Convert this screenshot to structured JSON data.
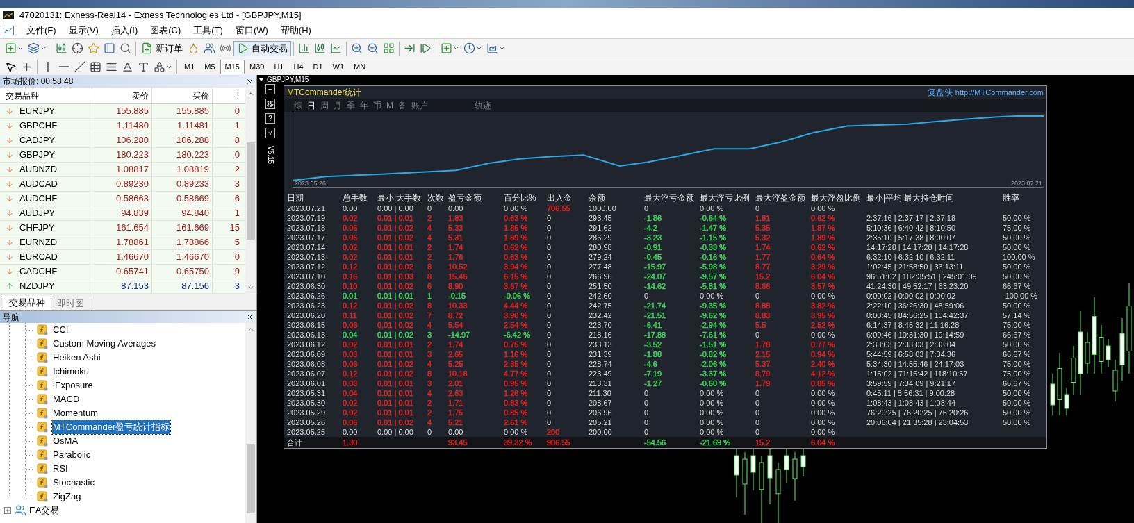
{
  "window": {
    "title": "47020131: Exness-Real14 - Exness Technologies Ltd - [GBPJPY,M15]"
  },
  "menu": [
    "文件(F)",
    "显示(V)",
    "插入(I)",
    "图表(C)",
    "工具(T)",
    "窗口(W)",
    "帮助(H)"
  ],
  "toolbar": {
    "new_order": "新订单",
    "auto_trading": "自动交易"
  },
  "timeframes": [
    {
      "label": "M1",
      "selected": false
    },
    {
      "label": "M5",
      "selected": false
    },
    {
      "label": "M15",
      "selected": true
    },
    {
      "label": "M30",
      "selected": false
    },
    {
      "label": "H1",
      "selected": false
    },
    {
      "label": "H4",
      "selected": false
    },
    {
      "label": "D1",
      "selected": false
    },
    {
      "label": "W1",
      "selected": false
    },
    {
      "label": "MN",
      "selected": false
    }
  ],
  "market_watch": {
    "title": "市场报价: 00:58:48",
    "columns": [
      "交易品种",
      "卖价",
      "买价",
      "!"
    ],
    "rows": [
      {
        "symbol": "EURJPY",
        "bid": "155.885",
        "ask": "155.885",
        "spread": "0",
        "kind": "down"
      },
      {
        "symbol": "GBPCHF",
        "bid": "1.11480",
        "ask": "1.11481",
        "spread": "1",
        "kind": "down"
      },
      {
        "symbol": "CADJPY",
        "bid": "106.280",
        "ask": "106.288",
        "spread": "8",
        "kind": "down"
      },
      {
        "symbol": "GBPJPY",
        "bid": "180.223",
        "ask": "180.223",
        "spread": "0",
        "kind": "down"
      },
      {
        "symbol": "AUDNZD",
        "bid": "1.08817",
        "ask": "1.08819",
        "spread": "2",
        "kind": "down"
      },
      {
        "symbol": "AUDCAD",
        "bid": "0.89230",
        "ask": "0.89233",
        "spread": "3",
        "kind": "down"
      },
      {
        "symbol": "AUDCHF",
        "bid": "0.58663",
        "ask": "0.58669",
        "spread": "6",
        "kind": "down"
      },
      {
        "symbol": "AUDJPY",
        "bid": "94.839",
        "ask": "94.840",
        "spread": "1",
        "kind": "down"
      },
      {
        "symbol": "CHFJPY",
        "bid": "161.654",
        "ask": "161.669",
        "spread": "15",
        "kind": "down"
      },
      {
        "symbol": "EURNZD",
        "bid": "1.78861",
        "ask": "1.78866",
        "spread": "5",
        "kind": "down"
      },
      {
        "symbol": "EURCAD",
        "bid": "1.46670",
        "ask": "1.46670",
        "spread": "0",
        "kind": "down"
      },
      {
        "symbol": "CADCHF",
        "bid": "0.65741",
        "ask": "0.65750",
        "spread": "9",
        "kind": "down"
      },
      {
        "symbol": "NZDJPY",
        "bid": "87.153",
        "ask": "87.156",
        "spread": "3",
        "kind": "up"
      }
    ]
  },
  "market_tabs": [
    {
      "label": "交易品种",
      "selected": true
    },
    {
      "label": "即时图",
      "selected": false
    }
  ],
  "navigator": {
    "title": "导航",
    "items": [
      {
        "label": "CCI",
        "selected": false
      },
      {
        "label": "Custom Moving Averages",
        "selected": false
      },
      {
        "label": "Heiken Ashi",
        "selected": false
      },
      {
        "label": "Ichimoku",
        "selected": false
      },
      {
        "label": "iExposure",
        "selected": false
      },
      {
        "label": "MACD",
        "selected": false
      },
      {
        "label": "Momentum",
        "selected": false
      },
      {
        "label": "MTCommander盈亏统计指标",
        "selected": true
      },
      {
        "label": "OsMA",
        "selected": false
      },
      {
        "label": "Parabolic",
        "selected": false
      },
      {
        "label": "RSI",
        "selected": false
      },
      {
        "label": "Stochastic",
        "selected": false
      },
      {
        "label": "ZigZag",
        "selected": false
      }
    ],
    "folder": {
      "label": "EA交易",
      "expanded": false
    }
  },
  "chart": {
    "title": "GBPJPY,M15",
    "side_buttons": [
      "−",
      "移",
      "?",
      "√"
    ],
    "version": "V5.15"
  },
  "stats_panel": {
    "title": "MTCommander统计",
    "brand": "复盘侠",
    "url": "http://MTCommander.com",
    "tabs": [
      {
        "label": "综",
        "selected": false
      },
      {
        "label": "日",
        "selected": true
      },
      {
        "label": "周",
        "selected": false
      },
      {
        "label": "月",
        "selected": false
      },
      {
        "label": "季",
        "selected": false
      },
      {
        "label": "年",
        "selected": false
      },
      {
        "label": "币",
        "selected": false
      },
      {
        "label": "M",
        "selected": false
      },
      {
        "label": "备",
        "selected": false
      },
      {
        "label": "账户",
        "selected": false
      },
      {
        "label": "轨迹",
        "selected": false
      }
    ],
    "start_label": "2023.05.26",
    "end_label": "2023.07.21",
    "columns": [
      "日期",
      "总手数",
      "最小|大手数",
      "次数",
      "盈亏金额",
      "百分比%",
      "出入金",
      "余额",
      "最大浮亏金额",
      "最大浮亏比例",
      "最大浮盈金额",
      "最大浮盈比例",
      "最小|平均|最大持仓时间",
      "胜率"
    ],
    "rows": [
      {
        "cells": [
          "2023.07.21",
          "0.00",
          "0.00 | 0.00",
          "0",
          "0.00",
          "0.00 %",
          {
            "text": "706.55",
            "color": "#e02424"
          },
          "1000.00",
          "0",
          "0.00 %",
          "0",
          "0.00 %",
          null,
          null
        ]
      },
      {
        "cells": [
          "2023.07.19",
          {
            "text": "0.02",
            "color": "#e02424"
          },
          {
            "text": "0.01 | 0.01",
            "color": "#e02424"
          },
          {
            "text": "2",
            "color": "#e02424"
          },
          {
            "text": "1.83",
            "color": "#e02424"
          },
          {
            "text": "0.63 %",
            "color": "#e02424"
          },
          "0",
          "293.45",
          {
            "text": "-1.86",
            "color": "#3fd35a"
          },
          {
            "text": "-0.64 %",
            "color": "#3fd35a"
          },
          {
            "text": "1.81",
            "color": "#e02424"
          },
          {
            "text": "0.62 %",
            "color": "#e02424"
          },
          "2:37:16 | 2:37:17 | 2:37:18",
          "50.00 %"
        ]
      },
      {
        "cells": [
          "2023.07.18",
          {
            "text": "0.06",
            "color": "#e02424"
          },
          {
            "text": "0.01 | 0.02",
            "color": "#e02424"
          },
          {
            "text": "4",
            "color": "#e02424"
          },
          {
            "text": "5.33",
            "color": "#e02424"
          },
          {
            "text": "1.86 %",
            "color": "#e02424"
          },
          "0",
          "291.62",
          {
            "text": "-4.2",
            "color": "#3fd35a"
          },
          {
            "text": "-1.47 %",
            "color": "#3fd35a"
          },
          {
            "text": "5.35",
            "color": "#e02424"
          },
          {
            "text": "1.87 %",
            "color": "#e02424"
          },
          "5:10:36 | 6:40:42 | 8:10:50",
          "75.00 %"
        ]
      },
      {
        "cells": [
          "2023.07.17",
          {
            "text": "0.06",
            "color": "#e02424"
          },
          {
            "text": "0.01 | 0.02",
            "color": "#e02424"
          },
          {
            "text": "4",
            "color": "#e02424"
          },
          {
            "text": "5.31",
            "color": "#e02424"
          },
          {
            "text": "1.89 %",
            "color": "#e02424"
          },
          "0",
          "286.29",
          {
            "text": "-3.23",
            "color": "#3fd35a"
          },
          {
            "text": "-1.15 %",
            "color": "#3fd35a"
          },
          {
            "text": "5.32",
            "color": "#e02424"
          },
          {
            "text": "1.89 %",
            "color": "#e02424"
          },
          "2:35:10 | 5:17:38 | 8:00:07",
          "50.00 %"
        ]
      },
      {
        "cells": [
          "2023.07.14",
          {
            "text": "0.02",
            "color": "#e02424"
          },
          {
            "text": "0.01 | 0.01",
            "color": "#e02424"
          },
          {
            "text": "2",
            "color": "#e02424"
          },
          {
            "text": "1.74",
            "color": "#e02424"
          },
          {
            "text": "0.62 %",
            "color": "#e02424"
          },
          "0",
          "280.98",
          {
            "text": "-0.91",
            "color": "#3fd35a"
          },
          {
            "text": "-0.33 %",
            "color": "#3fd35a"
          },
          {
            "text": "1.74",
            "color": "#e02424"
          },
          {
            "text": "0.62 %",
            "color": "#e02424"
          },
          "14:17:28 | 14:17:28 | 14:17:28",
          "50.00 %"
        ]
      },
      {
        "cells": [
          "2023.07.13",
          {
            "text": "0.02",
            "color": "#e02424"
          },
          {
            "text": "0.01 | 0.01",
            "color": "#e02424"
          },
          {
            "text": "2",
            "color": "#e02424"
          },
          {
            "text": "1.76",
            "color": "#e02424"
          },
          {
            "text": "0.63 %",
            "color": "#e02424"
          },
          "0",
          "279.24",
          {
            "text": "-0.45",
            "color": "#3fd35a"
          },
          {
            "text": "-0.16 %",
            "color": "#3fd35a"
          },
          {
            "text": "1.77",
            "color": "#e02424"
          },
          {
            "text": "0.64 %",
            "color": "#e02424"
          },
          "6:32:10 | 6:32:10 | 6:32:11",
          "100.00 %"
        ]
      },
      {
        "cells": [
          "2023.07.12",
          {
            "text": "0.12",
            "color": "#e02424"
          },
          {
            "text": "0.01 | 0.02",
            "color": "#e02424"
          },
          {
            "text": "8",
            "color": "#e02424"
          },
          {
            "text": "10.52",
            "color": "#e02424"
          },
          {
            "text": "3.94 %",
            "color": "#e02424"
          },
          "0",
          "277.48",
          {
            "text": "-15.97",
            "color": "#3fd35a"
          },
          {
            "text": "-5.98 %",
            "color": "#3fd35a"
          },
          {
            "text": "8.77",
            "color": "#e02424"
          },
          {
            "text": "3.29 %",
            "color": "#e02424"
          },
          "1:02:45 | 21:58:50 | 33:13:11",
          "50.00 %"
        ]
      },
      {
        "cells": [
          "2023.07.10",
          {
            "text": "0.16",
            "color": "#e02424"
          },
          {
            "text": "0.01 | 0.03",
            "color": "#e02424"
          },
          {
            "text": "8",
            "color": "#e02424"
          },
          {
            "text": "15.46",
            "color": "#e02424"
          },
          {
            "text": "6.15 %",
            "color": "#e02424"
          },
          "0",
          "266.96",
          {
            "text": "-24.07",
            "color": "#3fd35a"
          },
          {
            "text": "-9.57 %",
            "color": "#3fd35a"
          },
          {
            "text": "15.2",
            "color": "#e02424"
          },
          {
            "text": "6.04 %",
            "color": "#e02424"
          },
          "96:51:02 | 182:35:51 | 245:01:09",
          "50.00 %"
        ]
      },
      {
        "cells": [
          "2023.06.30",
          {
            "text": "0.10",
            "color": "#e02424"
          },
          {
            "text": "0.01 | 0.02",
            "color": "#e02424"
          },
          {
            "text": "6",
            "color": "#e02424"
          },
          {
            "text": "8.90",
            "color": "#e02424"
          },
          {
            "text": "3.67 %",
            "color": "#e02424"
          },
          "0",
          "251.50",
          {
            "text": "-14.62",
            "color": "#3fd35a"
          },
          {
            "text": "-5.81 %",
            "color": "#3fd35a"
          },
          {
            "text": "8.66",
            "color": "#e02424"
          },
          {
            "text": "3.57 %",
            "color": "#e02424"
          },
          "41:24:30 | 49:52:17 | 63:23:20",
          "66.67 %"
        ]
      },
      {
        "cells": [
          "2023.06.26",
          {
            "text": "0.01",
            "color": "#3fd35a"
          },
          {
            "text": "0.01 | 0.01",
            "color": "#3fd35a"
          },
          {
            "text": "1",
            "color": "#3fd35a"
          },
          {
            "text": "-0.15",
            "color": "#3fd35a"
          },
          {
            "text": "-0.06 %",
            "color": "#3fd35a"
          },
          "0",
          "242.60",
          "0",
          "0.00 %",
          "0",
          "0.00 %",
          "0:00:02 | 0:00:02 | 0:00:02",
          "-100.00 %"
        ]
      },
      {
        "cells": [
          "2023.06.23",
          {
            "text": "0.12",
            "color": "#e02424"
          },
          {
            "text": "0.01 | 0.02",
            "color": "#e02424"
          },
          {
            "text": "8",
            "color": "#e02424"
          },
          {
            "text": "10.33",
            "color": "#e02424"
          },
          {
            "text": "4.44 %",
            "color": "#e02424"
          },
          "0",
          "242.75",
          {
            "text": "-21.74",
            "color": "#3fd35a"
          },
          {
            "text": "-9.35 %",
            "color": "#3fd35a"
          },
          {
            "text": "8.88",
            "color": "#e02424"
          },
          {
            "text": "3.82 %",
            "color": "#e02424"
          },
          "2:22:10 | 36:26:30 | 48:59:06",
          "50.00 %"
        ]
      },
      {
        "cells": [
          "2023.06.20",
          {
            "text": "0.11",
            "color": "#e02424"
          },
          {
            "text": "0.01 | 0.02",
            "color": "#e02424"
          },
          {
            "text": "7",
            "color": "#e02424"
          },
          {
            "text": "8.72",
            "color": "#e02424"
          },
          {
            "text": "3.90 %",
            "color": "#e02424"
          },
          "0",
          "232.42",
          {
            "text": "-21.51",
            "color": "#3fd35a"
          },
          {
            "text": "-9.62 %",
            "color": "#3fd35a"
          },
          {
            "text": "8.83",
            "color": "#e02424"
          },
          {
            "text": "3.95 %",
            "color": "#e02424"
          },
          "0:00:45 | 84:56:25 | 104:42:37",
          "57.14 %"
        ]
      },
      {
        "cells": [
          "2023.06.15",
          {
            "text": "0.06",
            "color": "#e02424"
          },
          {
            "text": "0.01 | 0.02",
            "color": "#e02424"
          },
          {
            "text": "4",
            "color": "#e02424"
          },
          {
            "text": "5.54",
            "color": "#e02424"
          },
          {
            "text": "2.54 %",
            "color": "#e02424"
          },
          "0",
          "223.70",
          {
            "text": "-6.41",
            "color": "#3fd35a"
          },
          {
            "text": "-2.94 %",
            "color": "#3fd35a"
          },
          {
            "text": "5.5",
            "color": "#e02424"
          },
          {
            "text": "2.52 %",
            "color": "#e02424"
          },
          "6:14:37 | 8:45:32 | 11:16:28",
          "75.00 %"
        ]
      },
      {
        "cells": [
          "2023.06.13",
          {
            "text": "0.04",
            "color": "#3fd35a"
          },
          {
            "text": "0.01 | 0.02",
            "color": "#3fd35a"
          },
          {
            "text": "3",
            "color": "#3fd35a"
          },
          {
            "text": "-14.97",
            "color": "#3fd35a"
          },
          {
            "text": "-6.42 %",
            "color": "#3fd35a"
          },
          "0",
          "218.16",
          {
            "text": "-17.88",
            "color": "#3fd35a"
          },
          {
            "text": "-7.61 %",
            "color": "#3fd35a"
          },
          "0",
          "0.00 %",
          "6:09:46 | 10:31:30 | 19:14:59",
          "66.67 %"
        ]
      },
      {
        "cells": [
          "2023.06.12",
          {
            "text": "0.02",
            "color": "#e02424"
          },
          {
            "text": "0.01 | 0.01",
            "color": "#e02424"
          },
          {
            "text": "2",
            "color": "#e02424"
          },
          {
            "text": "1.74",
            "color": "#e02424"
          },
          {
            "text": "0.75 %",
            "color": "#e02424"
          },
          "0",
          "233.13",
          {
            "text": "-3.52",
            "color": "#3fd35a"
          },
          {
            "text": "-1.51 %",
            "color": "#3fd35a"
          },
          {
            "text": "1.78",
            "color": "#e02424"
          },
          {
            "text": "0.77 %",
            "color": "#e02424"
          },
          "2:33:03 | 2:33:03 | 2:33:04",
          "50.00 %"
        ]
      },
      {
        "cells": [
          "2023.06.09",
          {
            "text": "0.03",
            "color": "#e02424"
          },
          {
            "text": "0.01 | 0.01",
            "color": "#e02424"
          },
          {
            "text": "3",
            "color": "#e02424"
          },
          {
            "text": "2.65",
            "color": "#e02424"
          },
          {
            "text": "1.16 %",
            "color": "#e02424"
          },
          "0",
          "231.39",
          {
            "text": "-1.88",
            "color": "#3fd35a"
          },
          {
            "text": "-0.82 %",
            "color": "#3fd35a"
          },
          {
            "text": "2.15",
            "color": "#e02424"
          },
          {
            "text": "0.94 %",
            "color": "#e02424"
          },
          "5:44:59 | 6:58:03 | 7:34:36",
          "66.67 %"
        ]
      },
      {
        "cells": [
          "2023.06.08",
          {
            "text": "0.06",
            "color": "#e02424"
          },
          {
            "text": "0.01 | 0.02",
            "color": "#e02424"
          },
          {
            "text": "4",
            "color": "#e02424"
          },
          {
            "text": "5.25",
            "color": "#e02424"
          },
          {
            "text": "2.35 %",
            "color": "#e02424"
          },
          "0",
          "228.74",
          {
            "text": "-4.6",
            "color": "#3fd35a"
          },
          {
            "text": "-2.06 %",
            "color": "#3fd35a"
          },
          {
            "text": "5.37",
            "color": "#e02424"
          },
          {
            "text": "2.40 %",
            "color": "#e02424"
          },
          "5:34:30 | 14:55:46 | 24:17:03",
          "75.00 %"
        ]
      },
      {
        "cells": [
          "2023.06.07",
          {
            "text": "0.12",
            "color": "#e02424"
          },
          {
            "text": "0.01 | 0.02",
            "color": "#e02424"
          },
          {
            "text": "8",
            "color": "#e02424"
          },
          {
            "text": "10.18",
            "color": "#e02424"
          },
          {
            "text": "4.77 %",
            "color": "#e02424"
          },
          "0",
          "223.49",
          {
            "text": "-7.19",
            "color": "#3fd35a"
          },
          {
            "text": "-3.37 %",
            "color": "#3fd35a"
          },
          {
            "text": "8.79",
            "color": "#e02424"
          },
          {
            "text": "4.12 %",
            "color": "#e02424"
          },
          "1:15:02 | 71:15:42 | 118:10:57",
          "75.00 %"
        ]
      },
      {
        "cells": [
          "2023.06.01",
          {
            "text": "0.03",
            "color": "#e02424"
          },
          {
            "text": "0.01 | 0.01",
            "color": "#e02424"
          },
          {
            "text": "3",
            "color": "#e02424"
          },
          {
            "text": "2.01",
            "color": "#e02424"
          },
          {
            "text": "0.95 %",
            "color": "#e02424"
          },
          "0",
          "213.31",
          {
            "text": "-1.27",
            "color": "#3fd35a"
          },
          {
            "text": "-0.60 %",
            "color": "#3fd35a"
          },
          {
            "text": "1.79",
            "color": "#e02424"
          },
          {
            "text": "0.85 %",
            "color": "#e02424"
          },
          "3:59:59 | 7:34:09 | 9:21:17",
          "66.67 %"
        ]
      },
      {
        "cells": [
          "2023.05.31",
          {
            "text": "0.04",
            "color": "#e02424"
          },
          {
            "text": "0.01 | 0.01",
            "color": "#e02424"
          },
          {
            "text": "4",
            "color": "#e02424"
          },
          {
            "text": "2.63",
            "color": "#e02424"
          },
          {
            "text": "1.26 %",
            "color": "#e02424"
          },
          "0",
          "211.30",
          "0",
          "0.00 %",
          "0",
          "0.00 %",
          "0:45:11 | 5:56:31 | 9:00:28",
          "50.00 %"
        ]
      },
      {
        "cells": [
          "2023.05.30",
          {
            "text": "0.02",
            "color": "#e02424"
          },
          {
            "text": "0.01 | 0.01",
            "color": "#e02424"
          },
          {
            "text": "2",
            "color": "#e02424"
          },
          {
            "text": "1.71",
            "color": "#e02424"
          },
          {
            "text": "0.83 %",
            "color": "#e02424"
          },
          "0",
          "208.67",
          "0",
          "0.00 %",
          "0",
          "0.00 %",
          "1:08:43 | 1:08:43 | 1:08:44",
          "50.00 %"
        ]
      },
      {
        "cells": [
          "2023.05.29",
          {
            "text": "0.02",
            "color": "#e02424"
          },
          {
            "text": "0.01 | 0.01",
            "color": "#e02424"
          },
          {
            "text": "2",
            "color": "#e02424"
          },
          {
            "text": "1.75",
            "color": "#e02424"
          },
          {
            "text": "0.85 %",
            "color": "#e02424"
          },
          "0",
          "206.96",
          "0",
          "0.00 %",
          "0",
          "0.00 %",
          "76:20:25 | 76:20:25 | 76:20:26",
          "50.00 %"
        ]
      },
      {
        "cells": [
          "2023.05.26",
          {
            "text": "0.06",
            "color": "#e02424"
          },
          {
            "text": "0.01 | 0.02",
            "color": "#e02424"
          },
          {
            "text": "4",
            "color": "#e02424"
          },
          {
            "text": "5.21",
            "color": "#e02424"
          },
          {
            "text": "2.61 %",
            "color": "#e02424"
          },
          "0",
          "205.21",
          "0",
          "0.00 %",
          "0",
          "0.00 %",
          "20:06:04 | 21:35:28 | 23:04:53",
          "50.00 %"
        ]
      },
      {
        "cells": [
          "2023.05.25",
          "0.00",
          "0.00 | 0.00",
          "0",
          "0.00",
          "0.00 %",
          {
            "text": "200",
            "color": "#e02424"
          },
          "200.00",
          "0",
          "0.00 %",
          "0",
          "0.00 %",
          null,
          null
        ]
      }
    ],
    "total": {
      "cells": [
        "合计",
        {
          "text": "1.30",
          "color": "#e02424"
        },
        null,
        null,
        {
          "text": "93.45",
          "color": "#e02424"
        },
        {
          "text": "39.32 %",
          "color": "#e02424"
        },
        {
          "text": "906.55",
          "color": "#e02424"
        },
        null,
        {
          "text": "-54.56",
          "color": "#3fd35a"
        },
        {
          "text": "-21.69 %",
          "color": "#3fd35a"
        },
        {
          "text": "15.2",
          "color": "#e02424"
        },
        {
          "text": "6.04 %",
          "color": "#e02424"
        },
        null,
        null
      ]
    }
  }
}
